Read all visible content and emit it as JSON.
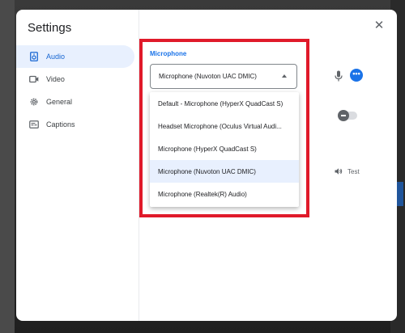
{
  "dialog": {
    "title": "Settings",
    "close_label": "✕"
  },
  "sidebar": {
    "items": [
      {
        "label": "Audio",
        "icon": "speaker-box-icon",
        "active": true
      },
      {
        "label": "Video",
        "icon": "video-camera-icon",
        "active": false
      },
      {
        "label": "General",
        "icon": "gear-icon",
        "active": false
      },
      {
        "label": "Captions",
        "icon": "captions-icon",
        "active": false
      }
    ]
  },
  "microphone": {
    "section_label": "Microphone",
    "selected_value": "Microphone (Nuvoton UAC DMIC)",
    "options": [
      "Default - Microphone (HyperX QuadCast S)",
      "Headset Microphone (Oculus Virtual Audi...",
      "Microphone (HyperX QuadCast S)",
      "Microphone (Nuvoton UAC DMIC)",
      "Microphone (Realtek(R) Audio)"
    ],
    "selected_index": 3
  },
  "right_controls": {
    "more_label": "•••",
    "test_label": "Test"
  },
  "colors": {
    "accent": "#1a73e8",
    "selected_bg": "#e8f0fe",
    "highlight_border": "#e01a2a"
  }
}
